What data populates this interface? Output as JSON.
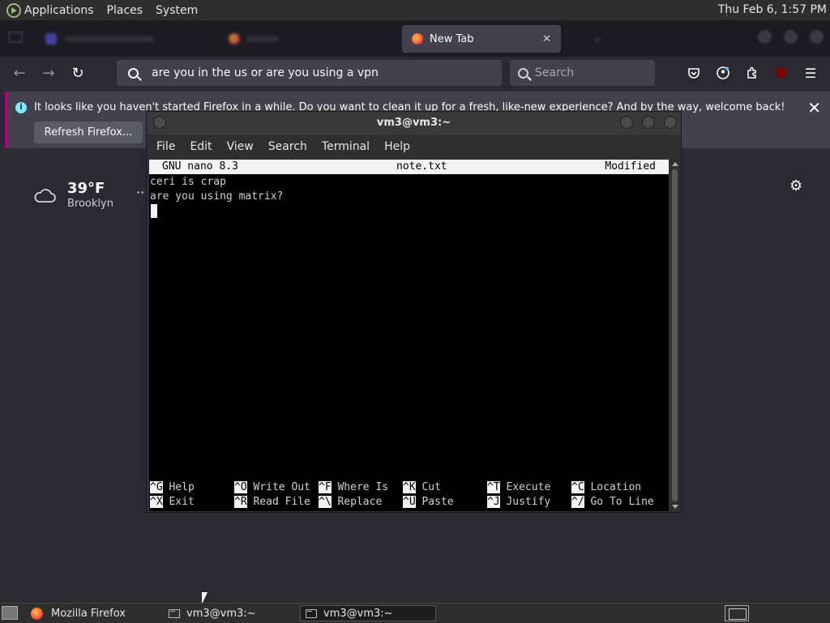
{
  "top_panel": {
    "menus": [
      "Applications",
      "Places",
      "System"
    ],
    "clock": "Thu Feb  6,  1:57 PM"
  },
  "browser": {
    "tabs": [
      {
        "label": "",
        "blurred": true
      },
      {
        "label": "",
        "blurred": true
      },
      {
        "label": "New Tab",
        "active": true
      }
    ],
    "url": "are you in the us or are you using a vpn",
    "search_placeholder": "Search",
    "notification": {
      "message": "It looks like you haven't started Firefox in a while. Do you want to clean it up for a fresh, like-new experience? And by the way, welcome back!",
      "button": "Refresh Firefox..."
    },
    "weather": {
      "temp": "39°F",
      "city": "Brooklyn",
      "more": "···"
    }
  },
  "terminal": {
    "title": "vm3@vm3:~",
    "menus": [
      "File",
      "Edit",
      "View",
      "Search",
      "Terminal",
      "Help"
    ],
    "nano": {
      "version": "GNU nano 8.3",
      "filename": "note.txt",
      "status": "Modified",
      "lines": [
        "ceri is crap",
        "are you using matrix?"
      ],
      "shortcuts_row1": [
        {
          "key": "^G",
          "label": "Help"
        },
        {
          "key": "^O",
          "label": "Write Out"
        },
        {
          "key": "^F",
          "label": "Where Is"
        },
        {
          "key": "^K",
          "label": "Cut"
        },
        {
          "key": "^T",
          "label": "Execute"
        },
        {
          "key": "^C",
          "label": "Location"
        }
      ],
      "shortcuts_row2": [
        {
          "key": "^X",
          "label": "Exit"
        },
        {
          "key": "^R",
          "label": "Read File"
        },
        {
          "key": "^\\",
          "label": "Replace"
        },
        {
          "key": "^U",
          "label": "Paste"
        },
        {
          "key": "^J",
          "label": "Justify"
        },
        {
          "key": "^/",
          "label": "Go To Line"
        }
      ]
    }
  },
  "taskbar": {
    "tasks": [
      {
        "label": "Mozilla Firefox",
        "icon": "firefox-icon"
      },
      {
        "label": "vm3@vm3:~",
        "icon": "terminal-icon"
      },
      {
        "label": "vm3@vm3:~",
        "icon": "terminal-icon",
        "active": true
      }
    ]
  },
  "colors": {
    "accent": "#b5007f",
    "info": "#80ebff",
    "bg": "#2b2a33"
  }
}
